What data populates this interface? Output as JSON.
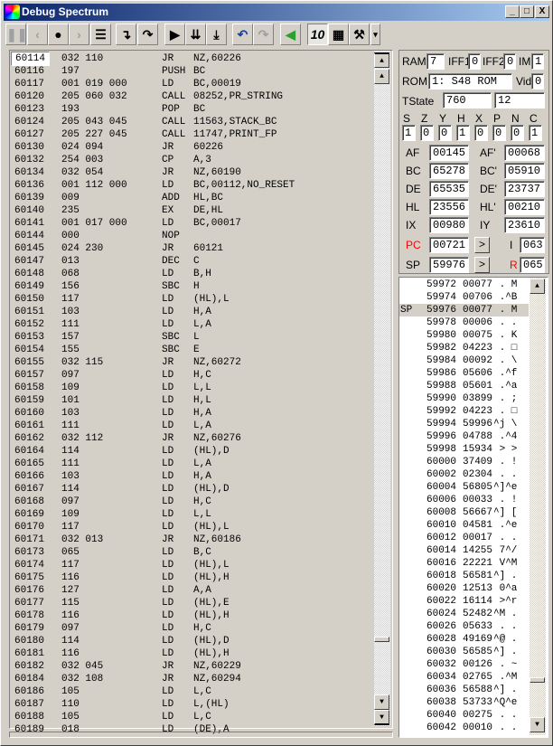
{
  "window": {
    "title": "Debug Spectrum",
    "min": "_",
    "max": "□",
    "close": "X"
  },
  "toolbar": [
    {
      "name": "pause-button",
      "glyph": "❚❚",
      "disabled": true
    },
    {
      "name": "step-back-button",
      "glyph": "‹",
      "disabled": true
    },
    {
      "name": "breakpoint-button",
      "glyph": "●",
      "disabled": false
    },
    {
      "name": "step-forward-button",
      "glyph": "›",
      "disabled": true
    },
    {
      "name": "list-button",
      "glyph": "☰",
      "disabled": false
    },
    {
      "name": "step-into-button",
      "glyph": "↴",
      "disabled": false
    },
    {
      "name": "step-over-button",
      "glyph": "↷",
      "disabled": false
    },
    {
      "name": "run-button",
      "glyph": "▶",
      "disabled": false
    },
    {
      "name": "run-to-button",
      "glyph": "⇊",
      "disabled": false
    },
    {
      "name": "run-frame-button",
      "glyph": "⤓",
      "disabled": false
    },
    {
      "name": "undo-button",
      "glyph": "↶",
      "disabled": false
    },
    {
      "name": "redo-button",
      "glyph": "↷",
      "disabled": true
    },
    {
      "name": "go-back-button",
      "glyph": "◀",
      "disabled": false
    },
    {
      "name": "decimal-toggle-button",
      "glyph": "10",
      "disabled": false
    },
    {
      "name": "memory-button",
      "glyph": "▦",
      "disabled": false
    },
    {
      "name": "tools-button",
      "glyph": "⚒",
      "disabled": false
    },
    {
      "name": "tools-dropdown-button",
      "glyph": "▾",
      "disabled": false
    }
  ],
  "accent": {
    "pc_label": "#ff0000",
    "r_label": "#ff0000",
    "go_back": "#2ca02c",
    "undo": "#1a3fa0"
  },
  "disasm": [
    [
      "60114",
      "032 110",
      "JR",
      "NZ,60226"
    ],
    [
      "60116",
      "197",
      "PUSH",
      "BC"
    ],
    [
      "60117",
      "001 019 000",
      "LD",
      "BC,00019"
    ],
    [
      "60120",
      "205 060 032",
      "CALL",
      "08252,PR_STRING"
    ],
    [
      "60123",
      "193",
      "POP",
      "BC"
    ],
    [
      "60124",
      "205 043 045",
      "CALL",
      "11563,STACK_BC"
    ],
    [
      "60127",
      "205 227 045",
      "CALL",
      "11747,PRINT_FP"
    ],
    [
      "60130",
      "024 094",
      "JR",
      "60226"
    ],
    [
      "60132",
      "254 003",
      "CP",
      "A,3"
    ],
    [
      "60134",
      "032 054",
      "JR",
      "NZ,60190"
    ],
    [
      "60136",
      "001 112 000",
      "LD",
      "BC,00112,NO_RESET"
    ],
    [
      "60139",
      "009",
      "ADD",
      "HL,BC"
    ],
    [
      "60140",
      "235",
      "EX",
      "DE,HL"
    ],
    [
      "60141",
      "001 017 000",
      "LD",
      "BC,00017"
    ],
    [
      "60144",
      "000",
      "NOP",
      ""
    ],
    [
      "60145",
      "024 230",
      "JR",
      "60121"
    ],
    [
      "60147",
      "013",
      "DEC",
      "C"
    ],
    [
      "60148",
      "068",
      "LD",
      "B,H"
    ],
    [
      "60149",
      "156",
      "SBC",
      "H"
    ],
    [
      "60150",
      "117",
      "LD",
      "(HL),L"
    ],
    [
      "60151",
      "103",
      "LD",
      "H,A"
    ],
    [
      "60152",
      "111",
      "LD",
      "L,A"
    ],
    [
      "60153",
      "157",
      "SBC",
      "L"
    ],
    [
      "60154",
      "155",
      "SBC",
      "E"
    ],
    [
      "60155",
      "032 115",
      "JR",
      "NZ,60272"
    ],
    [
      "60157",
      "097",
      "LD",
      "H,C"
    ],
    [
      "60158",
      "109",
      "LD",
      "L,L"
    ],
    [
      "60159",
      "101",
      "LD",
      "H,L"
    ],
    [
      "60160",
      "103",
      "LD",
      "H,A"
    ],
    [
      "60161",
      "111",
      "LD",
      "L,A"
    ],
    [
      "60162",
      "032 112",
      "JR",
      "NZ,60276"
    ],
    [
      "60164",
      "114",
      "LD",
      "(HL),D"
    ],
    [
      "60165",
      "111",
      "LD",
      "L,A"
    ],
    [
      "60166",
      "103",
      "LD",
      "H,A"
    ],
    [
      "60167",
      "114",
      "LD",
      "(HL),D"
    ],
    [
      "60168",
      "097",
      "LD",
      "H,C"
    ],
    [
      "60169",
      "109",
      "LD",
      "L,L"
    ],
    [
      "60170",
      "117",
      "LD",
      "(HL),L"
    ],
    [
      "60171",
      "032 013",
      "JR",
      "NZ,60186"
    ],
    [
      "60173",
      "065",
      "LD",
      "B,C"
    ],
    [
      "60174",
      "117",
      "LD",
      "(HL),L"
    ],
    [
      "60175",
      "116",
      "LD",
      "(HL),H"
    ],
    [
      "60176",
      "127",
      "LD",
      "A,A"
    ],
    [
      "60177",
      "115",
      "LD",
      "(HL),E"
    ],
    [
      "60178",
      "116",
      "LD",
      "(HL),H"
    ],
    [
      "60179",
      "097",
      "LD",
      "H,C"
    ],
    [
      "60180",
      "114",
      "LD",
      "(HL),D"
    ],
    [
      "60181",
      "116",
      "LD",
      "(HL),H"
    ],
    [
      "60182",
      "032 045",
      "JR",
      "NZ,60229"
    ],
    [
      "60184",
      "032 108",
      "JR",
      "NZ,60294"
    ],
    [
      "60186",
      "105",
      "LD",
      "L,C"
    ],
    [
      "60187",
      "110",
      "LD",
      "L,(HL)"
    ],
    [
      "60188",
      "105",
      "LD",
      "L,C"
    ],
    [
      "60189",
      "018",
      "LD",
      "(DE),A"
    ]
  ],
  "regs": {
    "ram_label": "RAM",
    "ram": "7",
    "iff1_label": "IFF1",
    "iff1": "0",
    "iff2_label": "IFF2",
    "iff2": "0",
    "im_label": "IM",
    "im": "1",
    "rom_label": "ROM",
    "rom": "1: S48 ROM",
    "vid_label": "Vid",
    "vid": "0",
    "tstate_label": "TState",
    "tstate": "760",
    "tstate2": "12",
    "flags": [
      [
        "S",
        "1"
      ],
      [
        "Z",
        "0"
      ],
      [
        "Y",
        "0"
      ],
      [
        "H",
        "1"
      ],
      [
        "X",
        "0"
      ],
      [
        "P",
        "0"
      ],
      [
        "N",
        "0"
      ],
      [
        "C",
        "1"
      ]
    ],
    "pairs": [
      [
        "AF",
        "00145",
        "AF'",
        "00068"
      ],
      [
        "BC",
        "65278",
        "BC'",
        "05910"
      ],
      [
        "DE",
        "65535",
        "DE'",
        "23737"
      ],
      [
        "HL",
        "23556",
        "HL'",
        "00210"
      ],
      [
        "IX",
        "00980",
        "IY",
        "23610"
      ]
    ],
    "pc_label": "PC",
    "pc": "00721",
    "sp_label": "SP",
    "sp": "59976",
    "goto": ">",
    "i_label": "I",
    "i": "063",
    "r_label": "R",
    "r": "065"
  },
  "stack": [
    [
      "",
      "59972",
      "00077",
      " . M"
    ],
    [
      "",
      "59974",
      "00706",
      " .^B"
    ],
    [
      "SP",
      "59976",
      "00077",
      " . M"
    ],
    [
      "",
      "59978",
      "00006",
      " . ."
    ],
    [
      "",
      "59980",
      "00075",
      " . K"
    ],
    [
      "",
      "59982",
      "04223",
      " . □"
    ],
    [
      "",
      "59984",
      "00092",
      " . \\"
    ],
    [
      "",
      "59986",
      "05606",
      " .^f"
    ],
    [
      "",
      "59988",
      "05601",
      " .^a"
    ],
    [
      "",
      "59990",
      "03899",
      " . ;"
    ],
    [
      "",
      "59992",
      "04223",
      " . □"
    ],
    [
      "",
      "59994",
      "59996",
      "^j \\"
    ],
    [
      "",
      "59996",
      "04788",
      " .^4"
    ],
    [
      "",
      "59998",
      "15934",
      " > >"
    ],
    [
      "",
      "60000",
      "37409",
      " . !"
    ],
    [
      "",
      "60002",
      "02304",
      " . ."
    ],
    [
      "",
      "60004",
      "56805",
      "^]^e"
    ],
    [
      "",
      "60006",
      "00033",
      " . !"
    ],
    [
      "",
      "60008",
      "56667",
      "^] ["
    ],
    [
      "",
      "60010",
      "04581",
      " .^e"
    ],
    [
      "",
      "60012",
      "00017",
      " . ."
    ],
    [
      "",
      "60014",
      "14255",
      " 7^/"
    ],
    [
      "",
      "60016",
      "22221",
      " V^M"
    ],
    [
      "",
      "60018",
      "56581",
      "^] ."
    ],
    [
      "",
      "60020",
      "12513",
      " 0^a"
    ],
    [
      "",
      "60022",
      "16114",
      " >^r"
    ],
    [
      "",
      "60024",
      "52482",
      "^M ."
    ],
    [
      "",
      "60026",
      "05633",
      " . ."
    ],
    [
      "",
      "60028",
      "49169",
      "^@ ."
    ],
    [
      "",
      "60030",
      "56585",
      "^] ."
    ],
    [
      "",
      "60032",
      "00126",
      " . ~"
    ],
    [
      "",
      "60034",
      "02765",
      " .^M"
    ],
    [
      "",
      "60036",
      "56588",
      "^] ."
    ],
    [
      "",
      "60038",
      "53733",
      "^Q^e"
    ],
    [
      "",
      "60040",
      "00275",
      " . ."
    ],
    [
      "",
      "60042",
      "00010",
      " . ."
    ]
  ]
}
